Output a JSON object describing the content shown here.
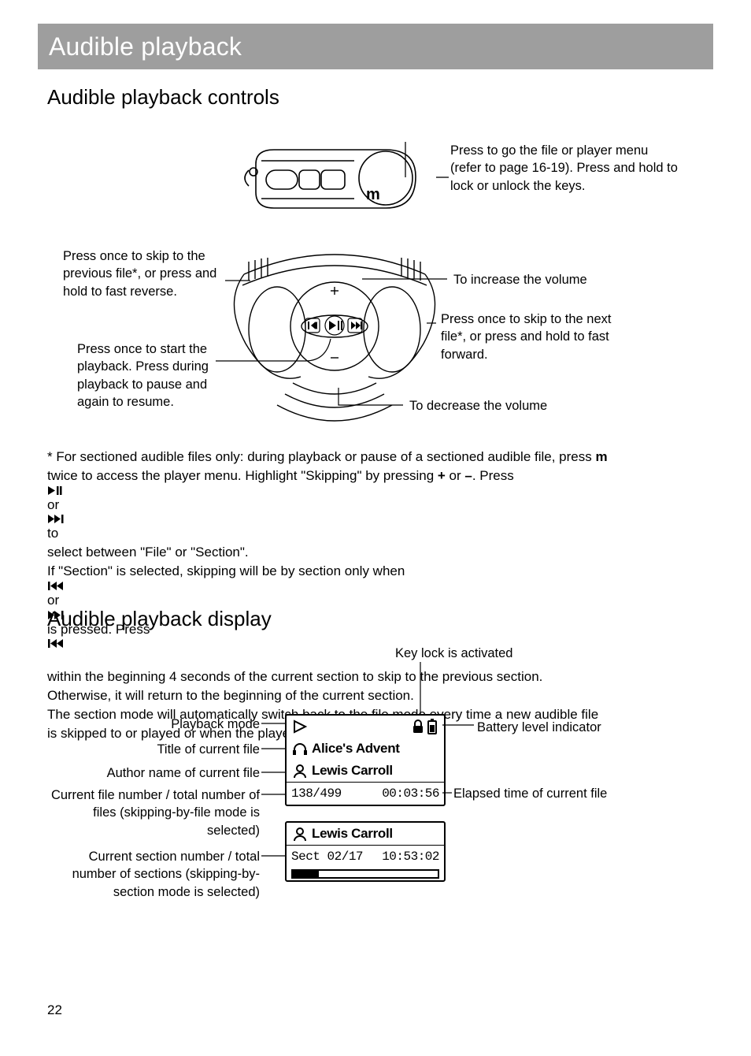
{
  "page_number": "22",
  "title_bar": "Audible playback",
  "section_controls": {
    "heading": "Audible playback controls",
    "m_label": "m",
    "callout_menu": "Press to go the file or player menu (refer to page 16-19). Press and hold to lock or unlock the keys.",
    "callout_prev": "Press once to skip to the previous file*, or press and hold to fast reverse.",
    "callout_vol_up": "To increase the volume",
    "callout_play": "Press once to start the playback. Press during playback to pause and again to resume.",
    "callout_next": "Press once to skip to the next file*, or press and hold to fast forward.",
    "callout_vol_down": "To decrease the volume"
  },
  "footnote": {
    "line1_a": "* For sectioned audible files only: during playback or pause of a sectioned audible file, press ",
    "line1_m": "m",
    "line2_a": "twice to access the player menu. Highlight \"Skipping\" by pressing ",
    "line2_plus": "+",
    "line2_b": " or ",
    "line2_minus": "–",
    "line2_c": ". Press ",
    "line2_playglyph": "▶||",
    "line2_d": " or ",
    "line2_ff": "▶▶|",
    "line2_e": " to",
    "line3": "select between \"File\" or \"Section\".",
    "line4_a": "If \"Section\" is selected, skipping will be by section only when ",
    "line4_prev": "|◀◀",
    "line4_b": " or ",
    "line4_next": "▶▶|",
    "line4_c": " is pressed. Press ",
    "line4_prev2": "|◀◀",
    "line5": "within the beginning 4 seconds of the current section to skip to the previous section.",
    "line6": "Otherwise, it will return to the beginning of the current section.",
    "line7": "The section mode will automatically switch back to the file mode every time a new audible file",
    "line8": "is skipped to or played or when the player is turned off."
  },
  "section_display": {
    "heading": "Audible playback display",
    "top_label": "Key lock is activated",
    "lcd1": {
      "title": "Alice's Advent",
      "author": "Lewis Carroll",
      "file_counter": "138/499",
      "elapsed": "00:03:56"
    },
    "lcd2": {
      "author": "Lewis Carroll",
      "section": "Sect 02/17",
      "elapsed": "10:53:02"
    },
    "left_labels": {
      "playback_mode": "Playback mode",
      "title": "Title of current file",
      "author": "Author name of current file",
      "file_counter": "Current file number / total number of files (skipping-by-file mode is selected)",
      "section_counter": "Current section number / total number of sections (skipping-by-section mode is selected)"
    },
    "right_labels": {
      "battery": "Battery level indicator",
      "elapsed": "Elapsed time of current file"
    }
  }
}
